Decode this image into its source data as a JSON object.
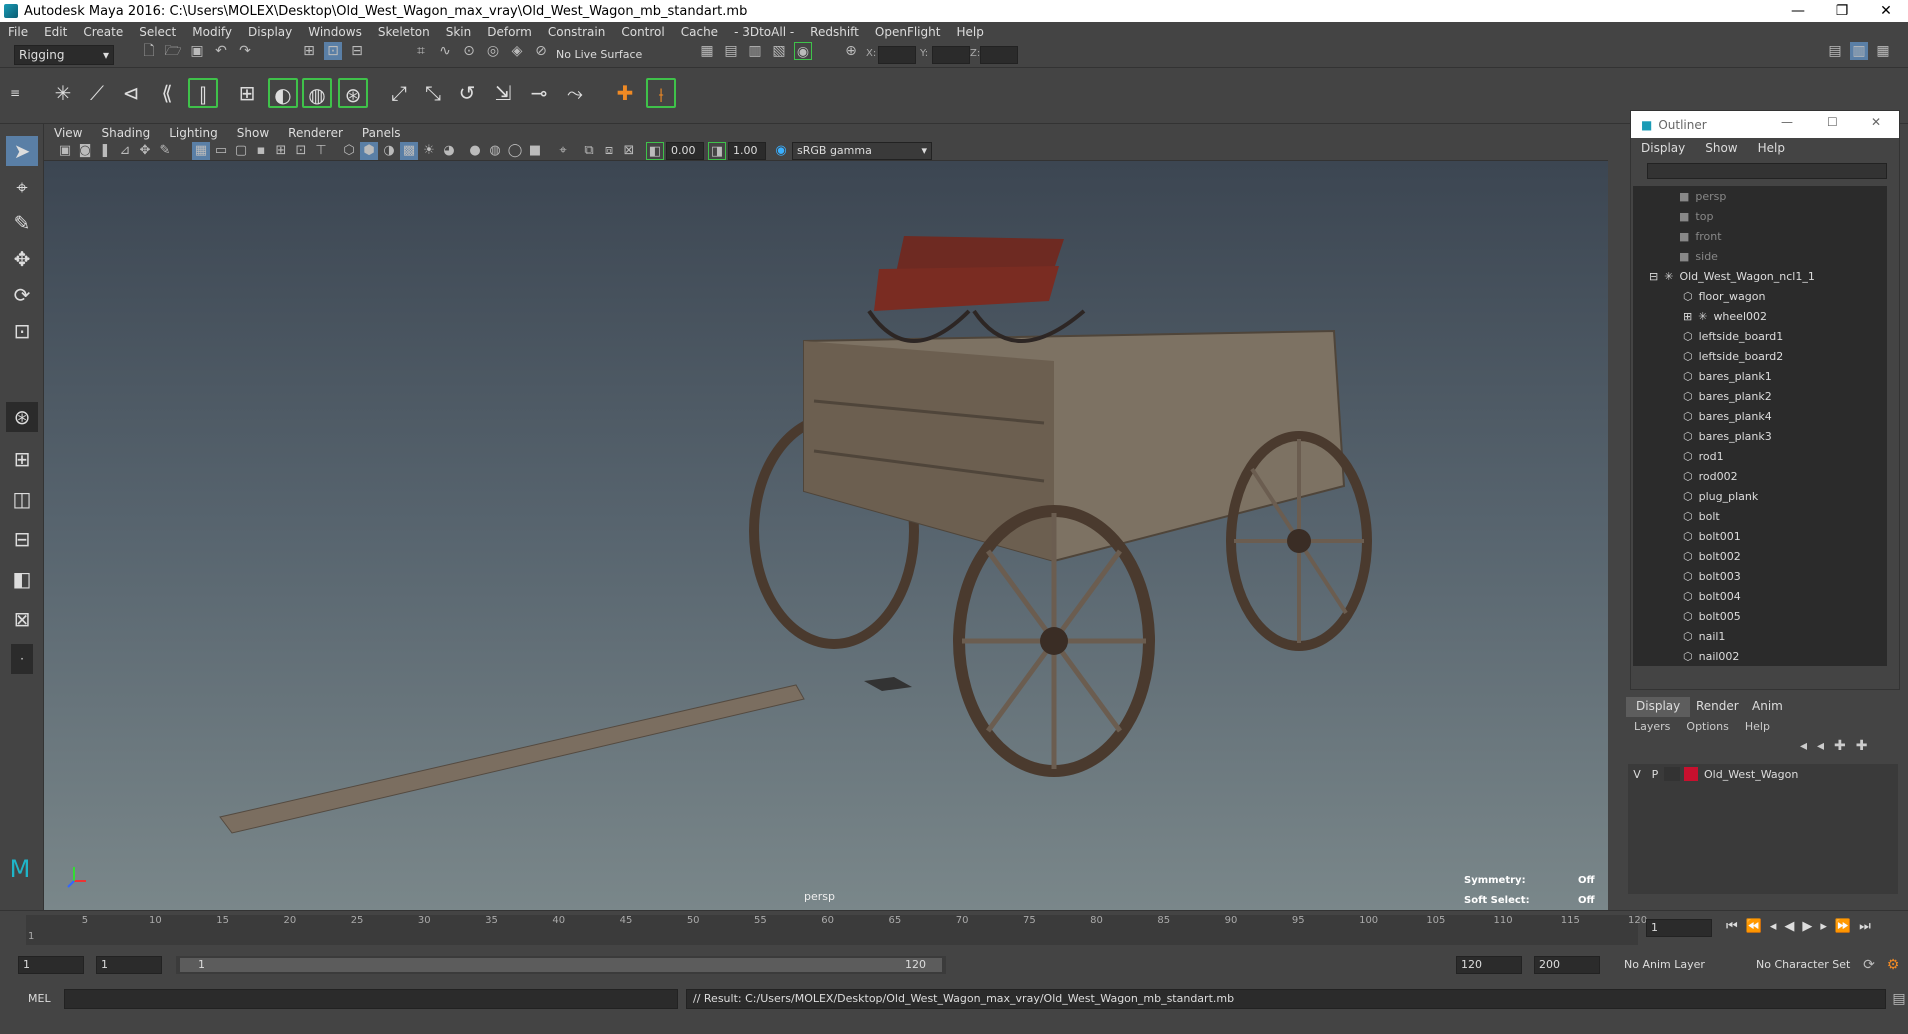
{
  "window": {
    "title": "Autodesk Maya 2016: C:\\Users\\MOLEX\\Desktop\\Old_West_Wagon_max_vray\\Old_West_Wagon_mb_standart.mb"
  },
  "menu": [
    "File",
    "Edit",
    "Create",
    "Select",
    "Modify",
    "Display",
    "Windows",
    "Skeleton",
    "Skin",
    "Deform",
    "Constrain",
    "Control",
    "Cache",
    "- 3DtoAll -",
    "Redshift",
    "OpenFlight",
    "Help"
  ],
  "statusline": {
    "mode": "Rigging",
    "live_surface": "No Live Surface",
    "x_label": "X:",
    "y_label": "Y:",
    "z_label": "Z:"
  },
  "viewport": {
    "menu": [
      "View",
      "Shading",
      "Lighting",
      "Show",
      "Renderer",
      "Panels"
    ],
    "exposure": "0.00",
    "gamma": "1.00",
    "color_space": "sRGB gamma",
    "camera": "persp",
    "hud": {
      "symmetry_label": "Symmetry:",
      "symmetry_value": "Off",
      "soft_select_label": "Soft Select:",
      "soft_select_value": "Off"
    }
  },
  "outliner": {
    "title": "Outliner",
    "menu": [
      "Display",
      "Show",
      "Help"
    ],
    "items": [
      {
        "label": "persp",
        "dim": true,
        "indent": 0
      },
      {
        "label": "top",
        "dim": true,
        "indent": 0
      },
      {
        "label": "front",
        "dim": true,
        "indent": 0
      },
      {
        "label": "side",
        "dim": true,
        "indent": 0
      },
      {
        "label": "Old_West_Wagon_ncl1_1",
        "dim": false,
        "indent": 0,
        "expanded": true
      },
      {
        "label": "floor_wagon",
        "dim": false,
        "indent": 1
      },
      {
        "label": "wheel002",
        "dim": false,
        "indent": 1,
        "collapsed": true
      },
      {
        "label": "leftside_board1",
        "dim": false,
        "indent": 1
      },
      {
        "label": "leftside_board2",
        "dim": false,
        "indent": 1
      },
      {
        "label": "bares_plank1",
        "dim": false,
        "indent": 1
      },
      {
        "label": "bares_plank2",
        "dim": false,
        "indent": 1
      },
      {
        "label": "bares_plank4",
        "dim": false,
        "indent": 1
      },
      {
        "label": "bares_plank3",
        "dim": false,
        "indent": 1
      },
      {
        "label": "rod1",
        "dim": false,
        "indent": 1
      },
      {
        "label": "rod002",
        "dim": false,
        "indent": 1
      },
      {
        "label": "plug_plank",
        "dim": false,
        "indent": 1
      },
      {
        "label": "bolt",
        "dim": false,
        "indent": 1
      },
      {
        "label": "bolt001",
        "dim": false,
        "indent": 1
      },
      {
        "label": "bolt002",
        "dim": false,
        "indent": 1
      },
      {
        "label": "bolt003",
        "dim": false,
        "indent": 1
      },
      {
        "label": "bolt004",
        "dim": false,
        "indent": 1
      },
      {
        "label": "bolt005",
        "dim": false,
        "indent": 1
      },
      {
        "label": "nail1",
        "dim": false,
        "indent": 1
      },
      {
        "label": "nail002",
        "dim": false,
        "indent": 1
      }
    ]
  },
  "layer_editor": {
    "tabs": [
      "Display",
      "Render",
      "Anim"
    ],
    "active_tab": "Display",
    "menu": [
      "Layers",
      "Options",
      "Help"
    ],
    "layers": [
      {
        "v": "V",
        "p": "P",
        "color": "#c8102e",
        "name": "Old_West_Wagon"
      }
    ]
  },
  "timeline": {
    "ticks": [
      "1",
      "5",
      "10",
      "15",
      "20",
      "25",
      "30",
      "35",
      "40",
      "45",
      "50",
      "55",
      "60",
      "65",
      "70",
      "75",
      "80",
      "85",
      "90",
      "95",
      "100",
      "105",
      "110",
      "115",
      "120"
    ],
    "current_frame": "1"
  },
  "range": {
    "start": "1",
    "playback_start": "1",
    "slider_start": "1",
    "slider_end": "120",
    "playback_end": "120",
    "end": "200",
    "anim_layer": "No Anim Layer",
    "character_set": "No Character Set"
  },
  "command": {
    "lang": "MEL",
    "result": "// Result: C:/Users/MOLEX/Desktop/Old_West_Wagon_max_vray/Old_West_Wagon_mb_standart.mb"
  }
}
